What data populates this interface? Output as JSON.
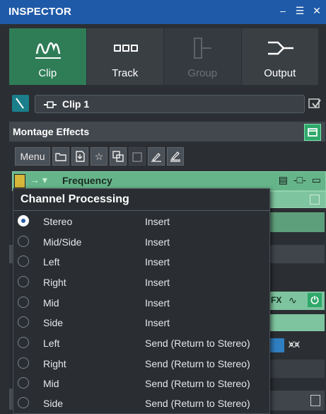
{
  "panel": {
    "title": "INSPECTOR"
  },
  "tabs": [
    {
      "label": "Clip",
      "state": "active"
    },
    {
      "label": "Track",
      "state": "normal"
    },
    {
      "label": "Group",
      "state": "disabled"
    },
    {
      "label": "Output",
      "state": "normal"
    }
  ],
  "clip": {
    "name": "Clip 1"
  },
  "section": {
    "title": "Montage Effects"
  },
  "toolbar": {
    "menu_label": "Menu"
  },
  "effect": {
    "name": "Frequency"
  },
  "popup": {
    "title": "Channel Processing",
    "options": [
      {
        "channel": "Stereo",
        "mode": "Insert",
        "selected": true
      },
      {
        "channel": "Mid/Side",
        "mode": "Insert",
        "selected": false
      },
      {
        "channel": "Left",
        "mode": "Insert",
        "selected": false
      },
      {
        "channel": "Right",
        "mode": "Insert",
        "selected": false
      },
      {
        "channel": "Mid",
        "mode": "Insert",
        "selected": false
      },
      {
        "channel": "Side",
        "mode": "Insert",
        "selected": false
      },
      {
        "channel": "Left",
        "mode": "Send (Return to Stereo)",
        "selected": false
      },
      {
        "channel": "Right",
        "mode": "Send (Return to Stereo)",
        "selected": false
      },
      {
        "channel": "Mid",
        "mode": "Send (Return to Stereo)",
        "selected": false
      },
      {
        "channel": "Side",
        "mode": "Send (Return to Stereo)",
        "selected": false
      }
    ]
  },
  "colors": {
    "header": "#1f5aa8",
    "active_tab": "#2f7d57",
    "effect_row": "#66b58a"
  }
}
